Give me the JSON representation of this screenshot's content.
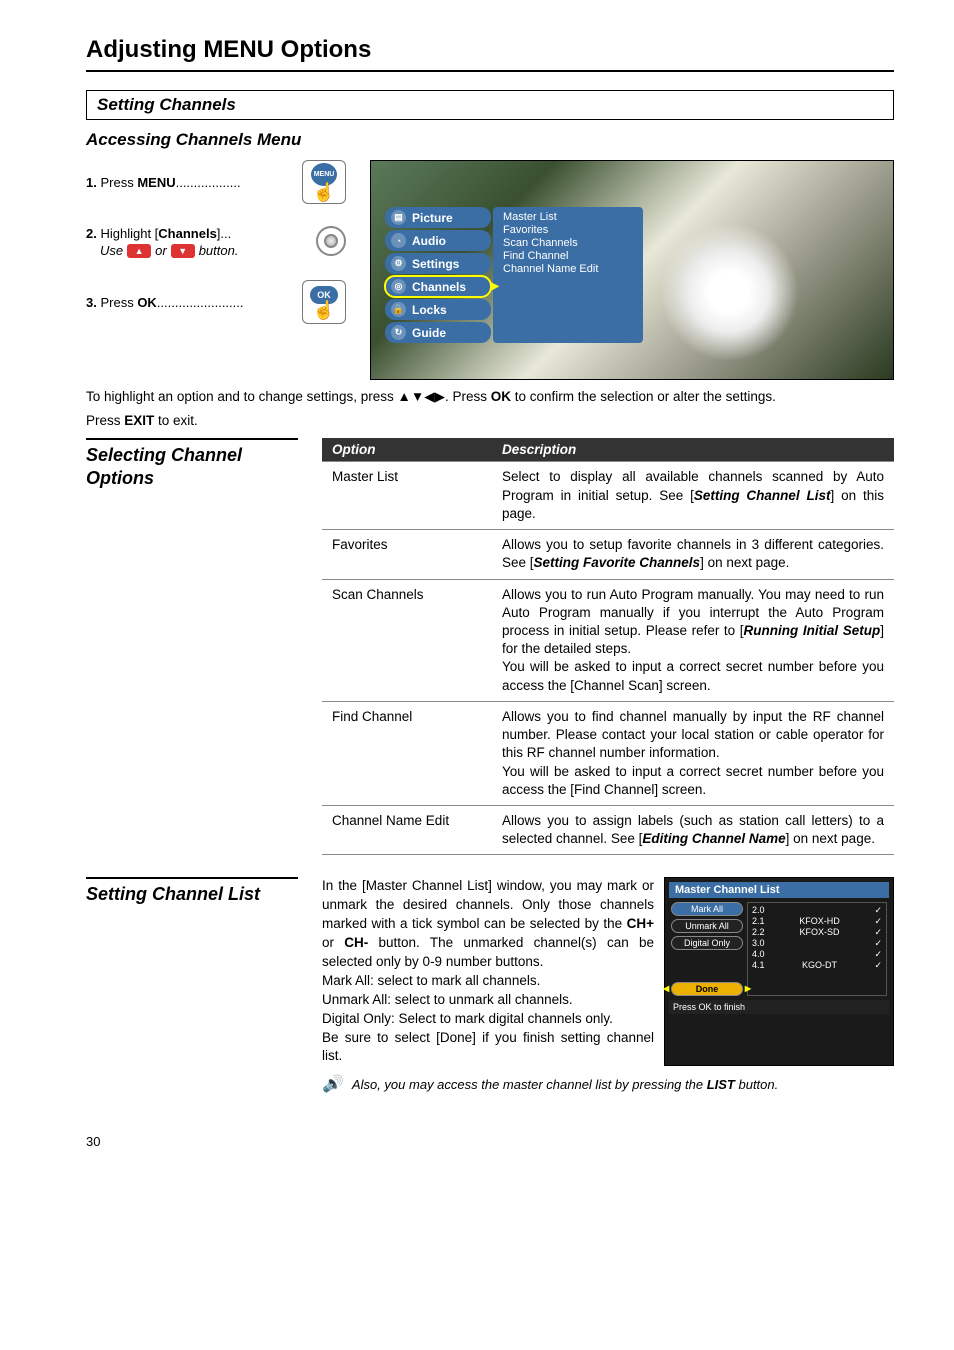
{
  "page": {
    "title": "Adjusting MENU Options",
    "number": "30"
  },
  "section": {
    "box_title": "Setting Channels",
    "accessing_title": "Accessing Channels Menu"
  },
  "steps": {
    "s1_prefix": "1. ",
    "s1_text": "Press ",
    "s1_bold": "MENU",
    "s2_prefix": "2. ",
    "s2_text": "Highlight [",
    "s2_bold": "Channels",
    "s2_suffix": "]...",
    "s2_use_a": "Use",
    "s2_use_b": "or",
    "s2_use_c": "button.",
    "s3_prefix": "3. ",
    "s3_text": "Press ",
    "s3_bold": "OK",
    "menu_label": "MENU",
    "ok_label": "OK"
  },
  "osd_menu": {
    "items": [
      "Picture",
      "Audio",
      "Settings",
      "Channels",
      "Locks",
      "Guide"
    ],
    "selected_index": 3,
    "sub_items": [
      "Master List",
      "Favorites",
      "Scan Channels",
      "Find Channel",
      "Channel Name Edit"
    ]
  },
  "instruction": {
    "line1_a": "To highlight an option and to change settings, press ",
    "line1_arrows": "▲▼◀▶",
    "line1_b": ". Press ",
    "line1_ok": "OK",
    "line1_c": " to confirm the selection or alter the settings.",
    "line2_a": "Press ",
    "line2_exit": "EXIT",
    "line2_b": " to exit."
  },
  "selecting": {
    "label_a": "Selecting Channel",
    "label_b": "Options",
    "th_option": "Option",
    "th_desc": "Description",
    "rows": [
      {
        "opt": "Master List",
        "desc_a": "Select to display all available channels scanned by Auto Program in initial setup. See [",
        "desc_bi": "Setting Channel List",
        "desc_b": "] on this page."
      },
      {
        "opt": "Favorites",
        "desc_a": "Allows you to setup favorite channels in 3 different categories. See [",
        "desc_bi": "Setting Favorite Channels",
        "desc_b": "] on next page."
      },
      {
        "opt": "Scan Channels",
        "desc_a": "Allows you to run Auto Program manually. You may need to run Auto Program manually if you interrupt the Auto Program process in initial setup. Please refer to [",
        "desc_bi": "Running Initial Setup",
        "desc_b": "] for the detailed steps.",
        "desc_c": "You will be asked to input a correct secret number before you access the [Channel Scan] screen."
      },
      {
        "opt": "Find Channel",
        "desc_a": "Allows you to find channel manually by input the RF channel number. Please contact your local station or cable operator for this RF channel number information.",
        "desc_c": "You will be asked to input a correct secret number before you access the [Find Channel] screen."
      },
      {
        "opt": "Channel Name Edit",
        "desc_a": "Allows you to assign labels (such as station call letters) to a selected channel. See [",
        "desc_bi": "Editing Channel Name",
        "desc_b": "] on next page."
      }
    ]
  },
  "setting_list": {
    "label": "Setting Channel List",
    "para_a": "In the [Master Channel List] window, you may mark or unmark the desired channels. Only those channels marked with a tick symbol can be selected by the ",
    "para_b1": "CH+",
    "para_mid": " or ",
    "para_b2": "CH-",
    "para_c": " button. The unmarked channel(s) can be selected only by 0-9 number buttons.",
    "line_mark": "Mark All: select to mark all channels.",
    "line_unmark": "Unmark All: select to unmark all channels.",
    "line_digital": "Digital Only: Select to mark digital channels only.",
    "line_done": "Be sure to select [Done] if you finish setting channel list.",
    "note_a": "Also, you may access the master channel list by pressing  the ",
    "note_bi": "LIST",
    "note_b": " button."
  },
  "mcl_osd": {
    "title": "Master Channel List",
    "mark": "Mark All",
    "unmark": "Unmark All",
    "digital": "Digital Only",
    "done": "Done",
    "foot": "Press OK to finish",
    "channels": [
      {
        "num": "2.0",
        "name": "",
        "tick": true
      },
      {
        "num": "2.1",
        "name": "KFOX-HD",
        "tick": true
      },
      {
        "num": "2.2",
        "name": "KFOX-SD",
        "tick": true
      },
      {
        "num": "3.0",
        "name": "",
        "tick": true
      },
      {
        "num": "4.0",
        "name": "",
        "tick": true
      },
      {
        "num": "4.1",
        "name": "KGO-DT",
        "tick": true
      }
    ]
  }
}
